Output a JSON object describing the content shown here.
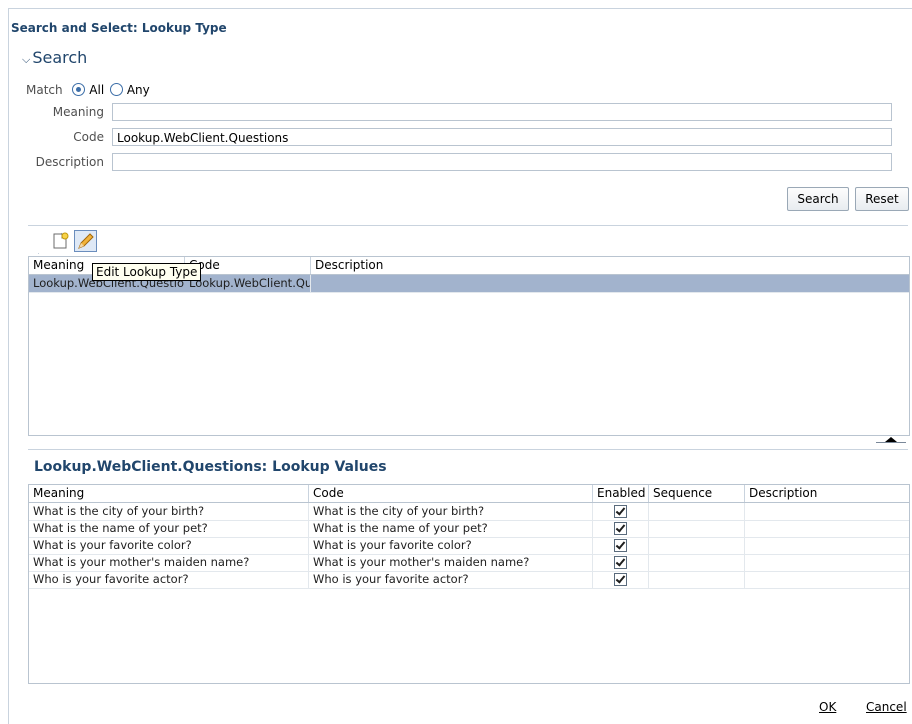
{
  "dialog": {
    "title": "Search and Select: Lookup Type"
  },
  "search": {
    "header": "Search",
    "match_label": "Match",
    "match_all": "All",
    "match_any": "Any",
    "meaning_label": "Meaning",
    "meaning_value": "",
    "code_label": "Code",
    "code_value": "Lookup.WebClient.Questions",
    "description_label": "Description",
    "description_value": "",
    "search_button": "Search",
    "reset_button": "Reset"
  },
  "toolbar": {
    "create_icon": "new-document-icon",
    "edit_icon": "pencil-icon",
    "tooltip": "Edit Lookup Type"
  },
  "results": {
    "columns": [
      "Meaning",
      "Code",
      "Description"
    ],
    "rows": [
      {
        "meaning": "Lookup.WebClient.Questio",
        "code": "Lookup.WebClient.Qu",
        "description": ""
      }
    ]
  },
  "values": {
    "title": "Lookup.WebClient.Questions: Lookup Values",
    "columns": [
      "Meaning",
      "Code",
      "Enabled",
      "Sequence",
      "Description"
    ],
    "rows": [
      {
        "meaning": "What is the city of your birth?",
        "code": "What is the city of your birth?",
        "enabled": true
      },
      {
        "meaning": "What is the name of your pet?",
        "code": "What is the name of your pet?",
        "enabled": true
      },
      {
        "meaning": "What is your favorite color?",
        "code": "What is your favorite color?",
        "enabled": true
      },
      {
        "meaning": "What is your mother's maiden name?",
        "code": "What is your mother's maiden name?",
        "enabled": true
      },
      {
        "meaning": "Who is your favorite actor?",
        "code": "Who is your favorite actor?",
        "enabled": true
      }
    ]
  },
  "footer": {
    "ok": "OK",
    "cancel": "Cancel"
  },
  "colors": {
    "title": "#21466c",
    "selected_row": "#a2b3cd"
  }
}
